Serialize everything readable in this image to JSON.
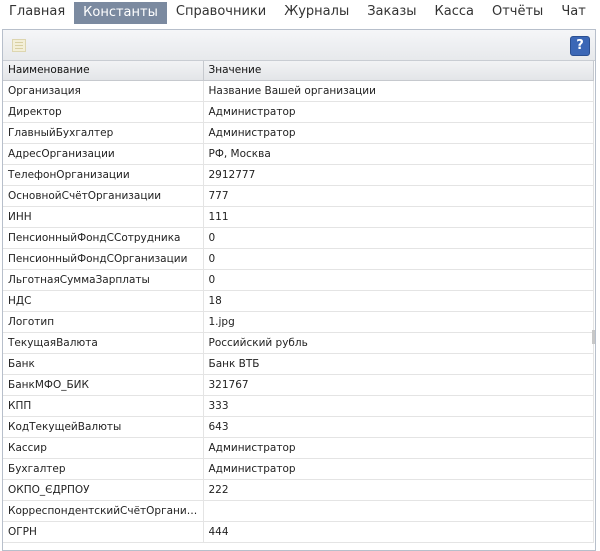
{
  "nav": {
    "items": [
      {
        "label": "Главная",
        "active": false
      },
      {
        "label": "Константы",
        "active": true
      },
      {
        "label": "Справочники",
        "active": false
      },
      {
        "label": "Журналы",
        "active": false
      },
      {
        "label": "Заказы",
        "active": false
      },
      {
        "label": "Касса",
        "active": false
      },
      {
        "label": "Отчёты",
        "active": false
      },
      {
        "label": "Чат",
        "active": false
      }
    ]
  },
  "toolbar": {
    "add_icon": "add-record-icon",
    "help_icon": "help-icon",
    "help_label": "?"
  },
  "table": {
    "columns": [
      "Наименование",
      "Значение"
    ],
    "rows": [
      [
        "Организация",
        "Название Вашей организации"
      ],
      [
        "Директор",
        "Администратор"
      ],
      [
        "ГлавныйБухгалтер",
        "Администратор"
      ],
      [
        "АдресОрганизации",
        "РФ, Москва"
      ],
      [
        "ТелефонОрганизации",
        "2912777"
      ],
      [
        "ОсновнойСчётОрганизации",
        "777"
      ],
      [
        "ИНН",
        "111"
      ],
      [
        "ПенсионныйФондССотрудника",
        "0"
      ],
      [
        "ПенсионныйФондСОрганизации",
        "0"
      ],
      [
        "ЛьготнаяСуммаЗарплаты",
        "0"
      ],
      [
        "НДС",
        "18"
      ],
      [
        "Логотип",
        "1.jpg"
      ],
      [
        "ТекущаяВалюта",
        "Российский рубль"
      ],
      [
        "Банк",
        "Банк ВТБ"
      ],
      [
        "БанкМФО_БИК",
        "321767"
      ],
      [
        "КПП",
        "333"
      ],
      [
        "КодТекущейВалюты",
        "643"
      ],
      [
        "Кассир",
        "Администратор"
      ],
      [
        "Бухгалтер",
        "Администратор"
      ],
      [
        "ОКПО_ЄДРПОУ",
        "222"
      ],
      [
        "КорреспондентскийСчётОрганизации",
        ""
      ],
      [
        "ОГРН",
        "444"
      ]
    ]
  }
}
